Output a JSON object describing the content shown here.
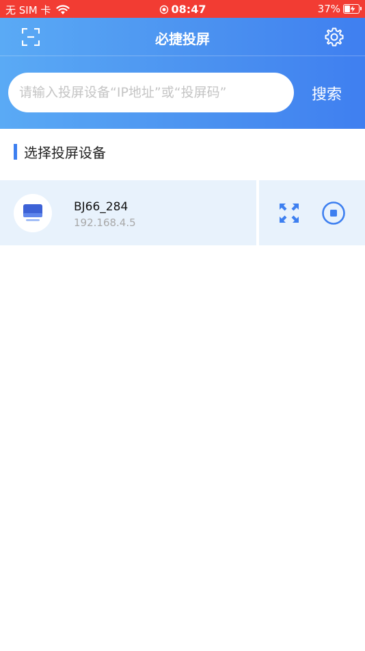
{
  "status_bar": {
    "carrier": "无 SIM 卡",
    "time": "08:47",
    "battery": "37%"
  },
  "navbar": {
    "title": "必捷投屏"
  },
  "search": {
    "placeholder": "请输入投屏设备“IP地址”或“投屏码”",
    "button_label": "搜索"
  },
  "section": {
    "title": "选择投屏设备"
  },
  "devices": [
    {
      "name": "BJ66_284",
      "ip": "192.168.4.5"
    }
  ],
  "colors": {
    "status_bar": "#f23c33",
    "accent": "#3d7ff0",
    "row_background": "#e8f2fc"
  }
}
